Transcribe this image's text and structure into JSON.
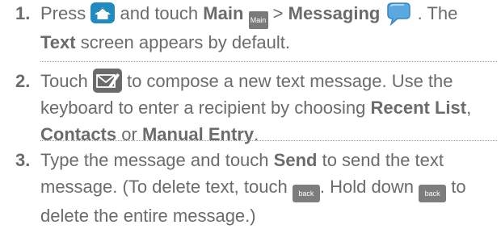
{
  "steps": [
    {
      "number": "1.",
      "parts": {
        "a": "Press",
        "b": "and touch",
        "c": "Main",
        "d": ">",
        "e": "Messaging",
        "f": ". The",
        "g": "Text",
        "h": "screen appears by default."
      }
    },
    {
      "number": "2.",
      "parts": {
        "a": "Touch",
        "b": "to compose a new text message. Use the keyboard to enter  a recipient by choosing",
        "c": "Recent List",
        "d": ",",
        "e": "Contacts",
        "f": "or",
        "g": "Manual Entry",
        "h": "."
      }
    },
    {
      "number": "3.",
      "parts": {
        "a": "Type the message and touch",
        "b": "Send",
        "c": "to send the text message. (To delete text, touch",
        "d": ". Hold down",
        "e": "to delete the entire message.)"
      }
    }
  ],
  "icons": {
    "main_icon_label": "Main",
    "back_key_label": "back",
    "home_icon": "home-icon",
    "messaging_icon": "speech-bubble-icon",
    "compose_icon": "compose-envelope-icon",
    "colors": {
      "text": "#6b6b6b",
      "home_blue": "#1f8bbf",
      "messaging_blue": "#5aa9e0"
    }
  }
}
